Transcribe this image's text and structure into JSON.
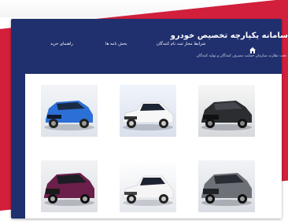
{
  "header": {
    "title": "سامانه یکپارچه تخصیص خودرو",
    "subtitle": "تحت نظارت سازمان حمایت مصرف کنندگان و تولید کنندگان",
    "home_icon": "home-icon",
    "nav": [
      {
        "label": "شرایط مجاز ثبت نام کنندگان"
      },
      {
        "label": "بخش نامه ها"
      },
      {
        "label": "راهنمای خرید"
      }
    ]
  },
  "cars": [
    {
      "name": "blue-suv",
      "color": "#2c6fd6"
    },
    {
      "name": "white-sedan",
      "color": "#f7f7f7"
    },
    {
      "name": "black-suv",
      "color": "#2b2d31"
    },
    {
      "name": "purple-suv",
      "color": "#6b1f4a"
    },
    {
      "name": "white-hatchback",
      "color": "#f5f5f5"
    },
    {
      "name": "grey-suv",
      "color": "#6d7177"
    }
  ],
  "colors": {
    "panel": "#20306e",
    "accent": "#d21f3c"
  }
}
